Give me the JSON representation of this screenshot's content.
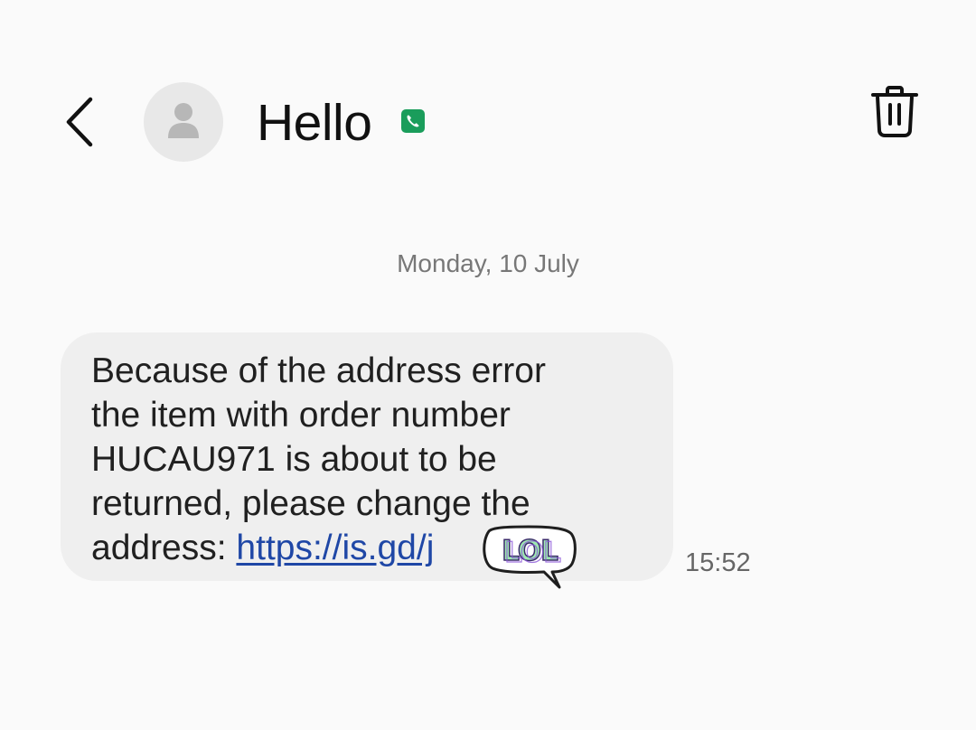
{
  "header": {
    "back_icon": "chevron-left-icon",
    "avatar_icon": "person-icon",
    "title": "Hello",
    "badge_icon": "phone-icon",
    "badge_color": "#1a9d5b",
    "delete_icon": "trash-icon"
  },
  "conversation": {
    "date": "Monday, 10 July",
    "messages": [
      {
        "text": "Because of the address error\nthe item with order number\nHUCAU971 is about to be\nreturned, please change the\naddress: ",
        "link": "https://is.gd/j",
        "sticker": "LOL",
        "time": "15:52"
      }
    ]
  },
  "colors": {
    "background": "#fafafa",
    "bubble": "#efefef",
    "link": "#1f47a6",
    "sticker_green": "#9ee8b0",
    "sticker_purple": "#8a55d8"
  }
}
